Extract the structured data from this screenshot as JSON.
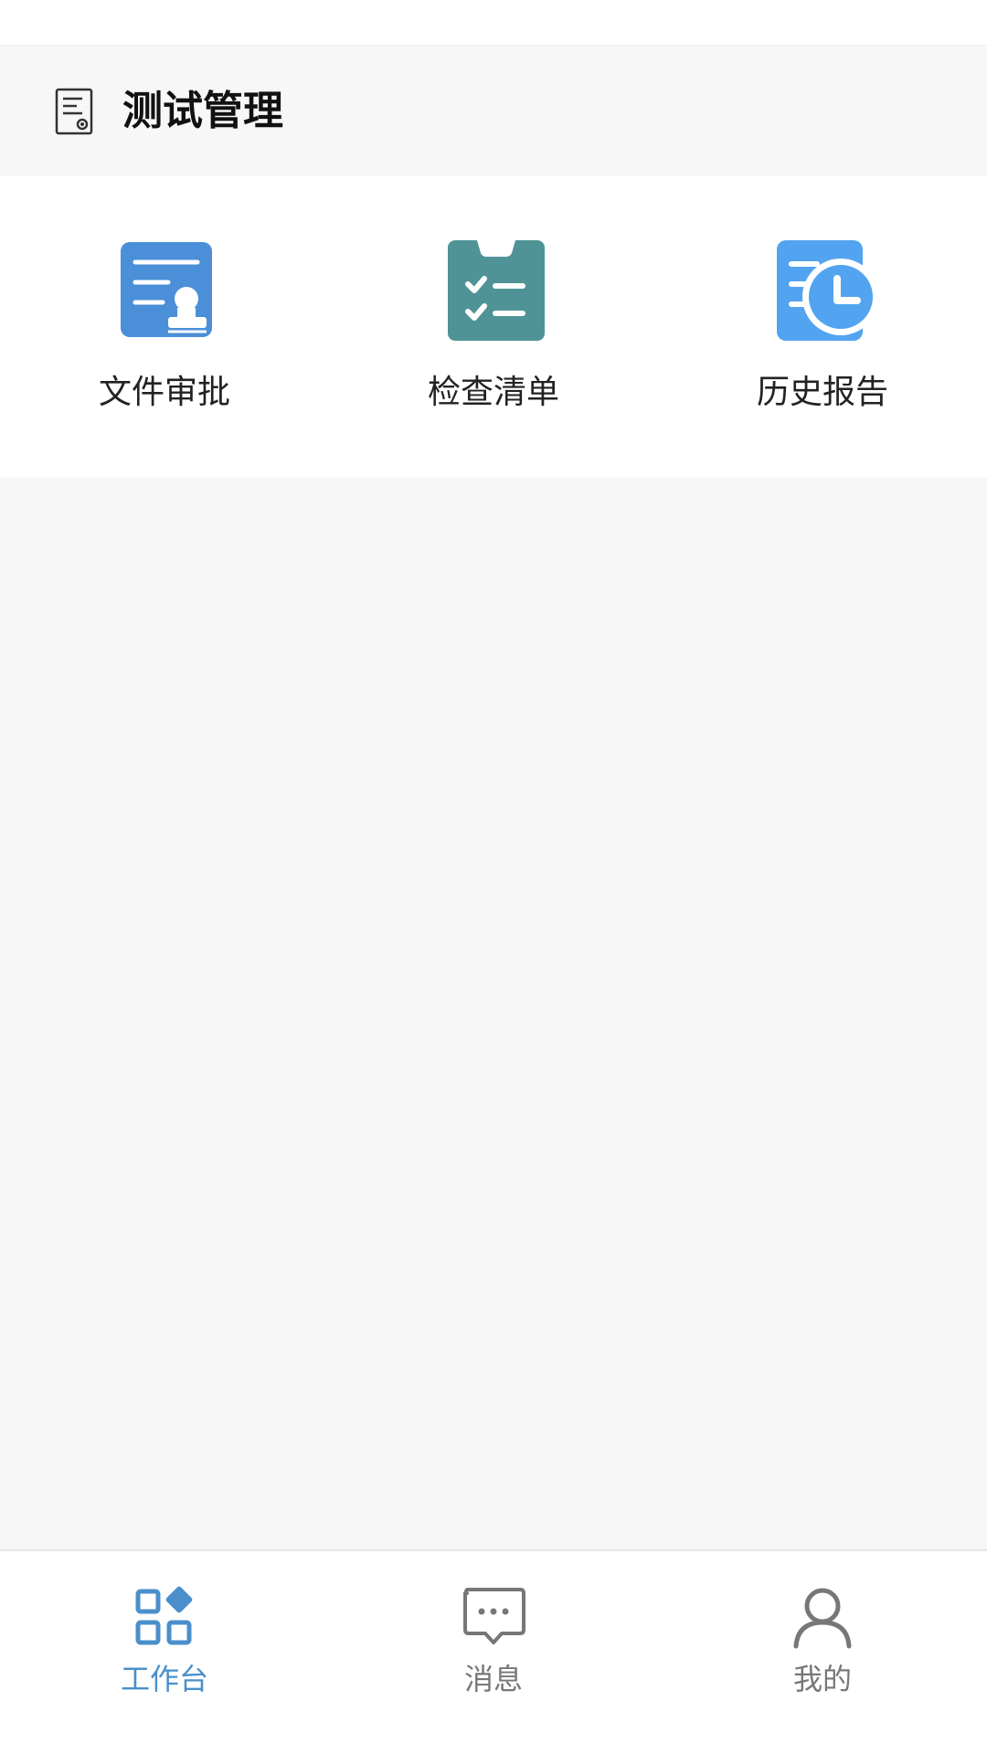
{
  "header": {
    "title": "测试管理",
    "icon": "document-icon"
  },
  "grid": {
    "items": [
      {
        "label": "文件审批",
        "icon": "file-approval-icon",
        "color": "#4a8fd8"
      },
      {
        "label": "检查清单",
        "icon": "checklist-icon",
        "color": "#4f9397"
      },
      {
        "label": "历史报告",
        "icon": "history-report-icon",
        "color": "#52a4f0"
      }
    ]
  },
  "tabbar": {
    "active_color": "#4a8fcb",
    "inactive_color": "#777777",
    "tabs": [
      {
        "label": "工作台",
        "icon": "workbench-icon",
        "active": true
      },
      {
        "label": "消息",
        "icon": "message-icon",
        "active": false
      },
      {
        "label": "我的",
        "icon": "profile-icon",
        "active": false
      }
    ]
  }
}
